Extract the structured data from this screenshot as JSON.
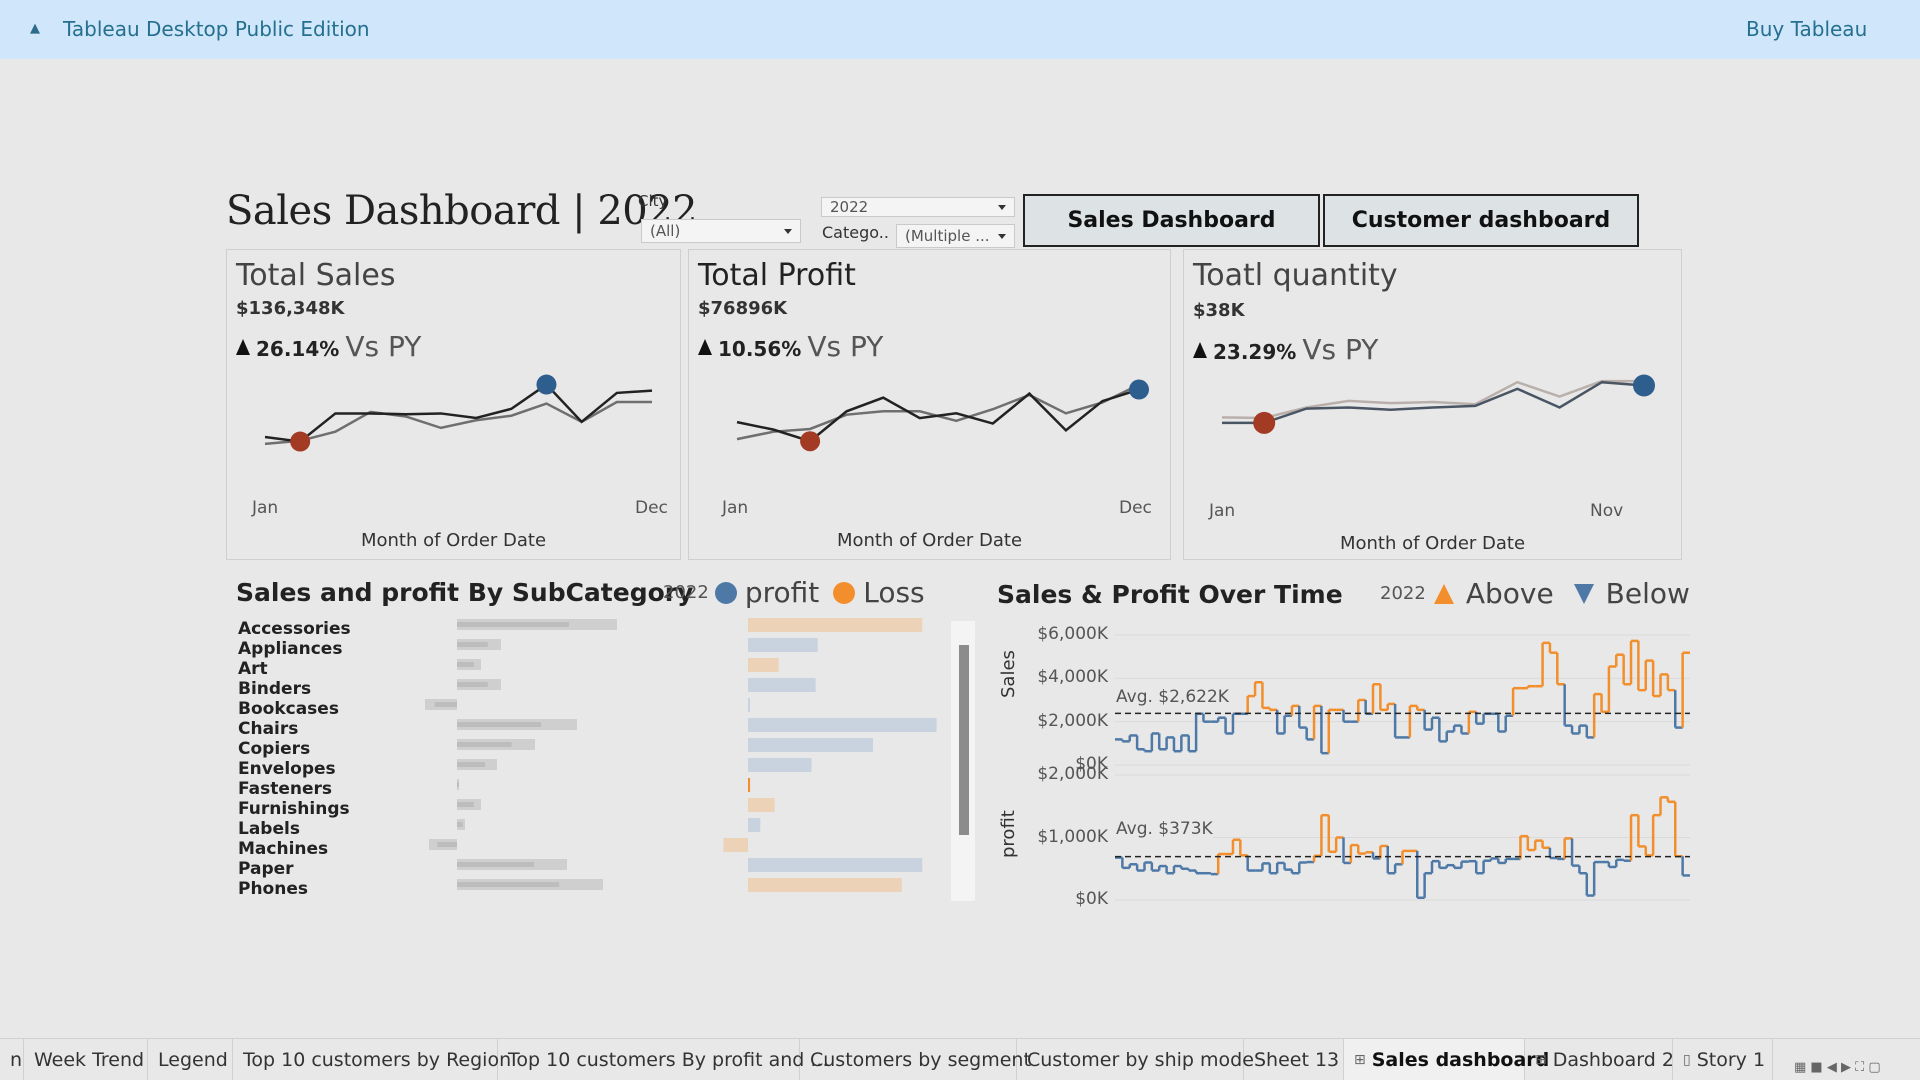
{
  "topbar": {
    "title": "Tableau Desktop Public Edition",
    "buy": "Buy Tableau"
  },
  "dashboard": {
    "title": "Sales Dashboard  | 2022"
  },
  "filters": {
    "city_label": "City",
    "city_value": "(All)",
    "year_value": "2022",
    "category_label": "Catego..",
    "category_value": "(Multiple ..."
  },
  "nav": {
    "sales_button": "Sales Dashboard",
    "customer_button": "Customer dashboard"
  },
  "kpis": [
    {
      "title": "Total Sales",
      "value": "$136,348K",
      "change": "26.14%",
      "vs": "Vs PY",
      "x_start": "Jan",
      "x_end": "Dec",
      "x_title": "Month of Order Date"
    },
    {
      "title": "Total Profit",
      "value": "$76896K",
      "change": "10.56%",
      "vs": "Vs PY",
      "x_start": "Jan",
      "x_end": "Dec",
      "x_title": "Month of Order Date"
    },
    {
      "title": "Toatl quantity",
      "value": "$38K",
      "change": "23.29%",
      "vs": "Vs PY",
      "x_start": "Jan",
      "x_end": "Nov",
      "x_title": "Month of Order Date"
    }
  ],
  "subcat_section": {
    "title": "Sales and profit By SubCategory",
    "legend_year": "2022",
    "legend_profit": "profit",
    "legend_loss": "Loss",
    "colors": {
      "profit": "#4e79a7",
      "loss": "#f28e2b"
    },
    "rows": [
      {
        "name": "Accessories",
        "status": "loss",
        "sales": 0.8,
        "profit": 0.85,
        "profit_kind": "loss"
      },
      {
        "name": "Appliances",
        "status": "none",
        "sales": 0.22,
        "profit": 0.34,
        "profit_kind": "profit"
      },
      {
        "name": "Art",
        "status": "loss",
        "sales": 0.12,
        "profit": 0.15,
        "profit_kind": "loss"
      },
      {
        "name": "Binders",
        "status": "none",
        "sales": 0.22,
        "profit": 0.33,
        "profit_kind": "profit"
      },
      {
        "name": "Bookcases",
        "status": "none",
        "sales": -0.16,
        "profit": 0.01,
        "profit_kind": "profit"
      },
      {
        "name": "Chairs",
        "status": "none",
        "sales": 0.6,
        "profit": 0.92,
        "profit_kind": "profit"
      },
      {
        "name": "Copiers",
        "status": "none",
        "sales": 0.39,
        "profit": 0.61,
        "profit_kind": "profit"
      },
      {
        "name": "Envelopes",
        "status": "none",
        "sales": 0.2,
        "profit": 0.31,
        "profit_kind": "profit"
      },
      {
        "name": "Fasteners",
        "status": "selected",
        "sales": 0.01,
        "profit": 0.01,
        "profit_kind": "loss"
      },
      {
        "name": "Furnishings",
        "status": "loss",
        "sales": 0.12,
        "profit": 0.13,
        "profit_kind": "loss"
      },
      {
        "name": "Labels",
        "status": "none",
        "sales": 0.04,
        "profit": 0.06,
        "profit_kind": "profit"
      },
      {
        "name": "Machines",
        "status": "loss",
        "sales": -0.14,
        "profit": -0.12,
        "profit_kind": "loss"
      },
      {
        "name": "Paper",
        "status": "none",
        "sales": 0.55,
        "profit": 0.85,
        "profit_kind": "profit"
      },
      {
        "name": "Phones",
        "status": "loss",
        "sales": 0.73,
        "profit": 0.75,
        "profit_kind": "loss"
      }
    ]
  },
  "time_section": {
    "title": "Sales & Profit Over Time",
    "legend_year": "2022",
    "legend_above": "Above",
    "legend_below": "Below",
    "colors": {
      "above": "#f28e2b",
      "below": "#4e79a7"
    },
    "sales_axis": {
      "label": "Sales",
      "ticks": [
        "$6,000K",
        "$4,000K",
        "$2,000K",
        "$0K"
      ],
      "avg_label": "Avg. $2,622K"
    },
    "profit_axis": {
      "label": "profit",
      "ticks": [
        "$2,000K",
        "$1,000K",
        "$0K"
      ],
      "avg_label": "Avg. $373K"
    }
  },
  "chart_data": [
    {
      "type": "line",
      "title": "Total Sales",
      "x": [
        "Jan",
        "Feb",
        "Mar",
        "Apr",
        "May",
        "Jun",
        "Jul",
        "Aug",
        "Sep",
        "Oct",
        "Nov",
        "Dec"
      ],
      "series": [
        {
          "values": [
            0.25,
            0.19,
            0.56,
            0.56,
            0.55,
            0.56,
            0.5,
            0.62,
            0.94,
            0.45,
            0.83,
            0.86
          ]
        },
        {
          "values": [
            0.16,
            0.2,
            0.32,
            0.58,
            0.52,
            0.37,
            0.47,
            0.53,
            0.69,
            0.45,
            0.71,
            0.71
          ]
        }
      ],
      "highlight_min": {
        "x": "Feb"
      },
      "highlight_max": {
        "x": "Sep"
      }
    },
    {
      "type": "line",
      "title": "Total Profit",
      "x": [
        "Jan",
        "Feb",
        "Mar",
        "Apr",
        "May",
        "Jun",
        "Jul",
        "Aug",
        "Sep",
        "Oct",
        "Nov",
        "Dec"
      ],
      "series": [
        {
          "values": [
            0.38,
            0.27,
            0.1,
            0.54,
            0.74,
            0.44,
            0.51,
            0.36,
            0.8,
            0.26,
            0.69,
            0.86
          ]
        },
        {
          "values": [
            0.13,
            0.24,
            0.28,
            0.49,
            0.54,
            0.54,
            0.4,
            0.57,
            0.78,
            0.51,
            0.67,
            0.93
          ]
        }
      ],
      "highlight_min": {
        "x": "Mar"
      },
      "highlight_max": {
        "x": "Dec"
      }
    },
    {
      "type": "line",
      "title": "Toatl quantity",
      "x": [
        "Jan",
        "Feb",
        "Mar",
        "Apr",
        "May",
        "Jun",
        "Jul",
        "Aug",
        "Sep",
        "Oct",
        "Nov"
      ],
      "series": [
        {
          "values": [
            0.22,
            0.22,
            0.48,
            0.5,
            0.46,
            0.5,
            0.53,
            0.84,
            0.5,
            0.96,
            0.9
          ]
        },
        {
          "values": [
            0.32,
            0.31,
            0.5,
            0.62,
            0.58,
            0.6,
            0.56,
            0.96,
            0.7,
            0.98,
            0.98
          ]
        }
      ],
      "highlight_min": {
        "x": "Feb"
      },
      "highlight_max": {
        "x": "Nov"
      }
    },
    {
      "type": "line",
      "title": "Sales & Profit Over Time — Sales",
      "ylabel": "Sales",
      "ylim": [
        0,
        6600
      ],
      "avg": 2622,
      "values": [
        1300,
        1200,
        1500,
        800,
        700,
        1600,
        800,
        1400,
        700,
        1500,
        700,
        2600,
        2200,
        2200,
        2400,
        1600,
        2600,
        2600,
        3500,
        4200,
        2900,
        2800,
        1600,
        2500,
        3000,
        1900,
        1300,
        3000,
        600,
        2800,
        2800,
        2200,
        2200,
        3300,
        2600,
        4100,
        2800,
        3100,
        1400,
        1400,
        3000,
        2800,
        1800,
        2400,
        1200,
        1700,
        2000,
        1600,
        2700,
        2100,
        2600,
        2600,
        1700,
        2500,
        3900,
        3900,
        4000,
        4000,
        6200,
        5700,
        4100,
        2000,
        1600,
        2000,
        1400,
        3600,
        2700,
        5000,
        5600,
        4100,
        6300,
        3800,
        5300,
        3500,
        4600,
        3800,
        1900,
        5700
      ]
    },
    {
      "type": "line",
      "title": "Sales & Profit Over Time — profit",
      "ylabel": "profit",
      "ylim": [
        -600,
        2200
      ],
      "avg": 373,
      "values": [
        350,
        120,
        200,
        60,
        240,
        60,
        160,
        0,
        160,
        100,
        60,
        0,
        0,
        -20,
        430,
        430,
        750,
        400,
        60,
        60,
        220,
        0,
        230,
        80,
        0,
        240,
        250,
        390,
        1300,
        480,
        800,
        230,
        630,
        440,
        470,
        330,
        610,
        0,
        200,
        500,
        500,
        -550,
        0,
        270,
        120,
        180,
        120,
        260,
        270,
        0,
        280,
        330,
        230,
        320,
        320,
        830,
        520,
        730,
        570,
        340,
        320,
        780,
        170,
        0,
        -500,
        250,
        250,
        140,
        300,
        280,
        1300,
        600,
        400,
        1300,
        1700,
        1600,
        380,
        -50
      ]
    }
  ],
  "tabs": [
    {
      "label": "n",
      "icon": ""
    },
    {
      "label": "Week Trend",
      "icon": ""
    },
    {
      "label": "Legend",
      "icon": ""
    },
    {
      "label": "Top 10 customers by Region",
      "icon": ""
    },
    {
      "label": "Top 10 customers By profit and ...",
      "icon": ""
    },
    {
      "label": "Customers by segment",
      "icon": ""
    },
    {
      "label": "Customer  by ship mode",
      "icon": ""
    },
    {
      "label": "Sheet 13",
      "icon": ""
    },
    {
      "label": "Sales dashboard",
      "icon": "⊞",
      "active": true
    },
    {
      "label": "Dashboard 2",
      "icon": "⊞"
    },
    {
      "label": "Story 1",
      "icon": "▯"
    }
  ]
}
